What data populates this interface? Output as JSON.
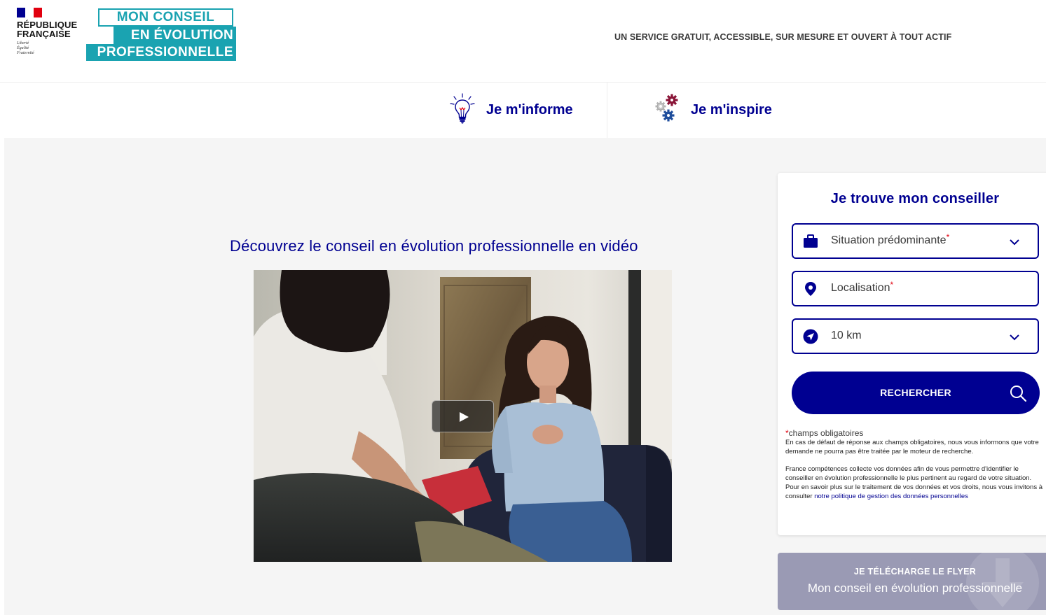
{
  "header": {
    "marianne": {
      "title_line1": "RÉPUBLIQUE",
      "title_line2": "FRANÇAISE",
      "motto": [
        "Liberté",
        "Égalité",
        "Fraternité"
      ],
      "flag_colors": [
        "#000091",
        "#ffffff",
        "#e1000f"
      ]
    },
    "logo": {
      "line1": "MON CONSEIL",
      "line2": "EN ÉVOLUTION",
      "line3": "PROFESSIONNELLE",
      "color": "#1aa3b1"
    },
    "tagline": "UN SERVICE GRATUIT, ACCESSIBLE, SUR MESURE ET OUVERT À TOUT ACTIF"
  },
  "nav": {
    "items": [
      {
        "label": "Je m'informe",
        "icon": "lightbulb-icon"
      },
      {
        "label": "Je m'inspire",
        "icon": "gears-icon"
      }
    ]
  },
  "video_section": {
    "title": "Découvrez le conseil en évolution professionnelle en vidéo",
    "play_icon": "play-icon"
  },
  "search_form": {
    "title": "Je trouve mon conseiller",
    "situation": {
      "value": "Situation prédominante",
      "required": "*",
      "icon": "briefcase-icon"
    },
    "localisation": {
      "placeholder": "Localisation",
      "required": "*",
      "icon": "location-pin-icon"
    },
    "rayon": {
      "value": "10 km",
      "icon": "navigation-arrow-icon"
    },
    "submit_label": "RECHERCHER",
    "required_mark": "*",
    "required_note": "champs obligatoires",
    "notice_1": "En cas de défaut de réponse aux champs obligatoires, nous vous informons que votre demande ne pourra pas être traitée par le moteur de recherche.",
    "notice_2": "France compétences collecte vos données afin de vous permettre d'identifier le conseiller en évolution professionnelle le plus pertinent au regard de votre situation. Pour en savoir plus sur le traitement de vos données et vos droits, nous vous invitons à consulter ",
    "privacy_link": "notre politique de gestion des données personnelles"
  },
  "flyer": {
    "line1": "JE TÉLÉCHARGE LE FLYER",
    "line2": "Mon conseil en évolution professionnelle",
    "icon": "download-icon"
  },
  "colors": {
    "primary": "#000091",
    "required": "#e1000f",
    "teal": "#1aa3b1",
    "flyer_bg": "#9a9ab4",
    "section_bg": "#f5f5f5"
  }
}
